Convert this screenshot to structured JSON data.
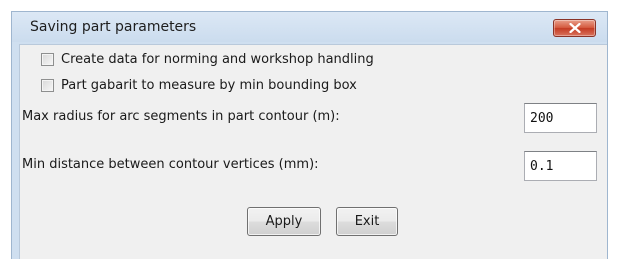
{
  "dialog": {
    "title": "Saving part parameters",
    "close_icon": "close-icon",
    "checkboxes": [
      {
        "label": "Create data for norming and workshop handling",
        "checked": false
      },
      {
        "label": "Part gabarit to measure by min bounding box",
        "checked": false
      }
    ],
    "fields": [
      {
        "label": "Max radius for arc segments in part contour (m):",
        "value": "200"
      },
      {
        "label": "Min distance between contour vertices (mm):",
        "value": "0.1"
      }
    ],
    "buttons": {
      "apply": "Apply",
      "exit": "Exit"
    },
    "colors": {
      "titlebar": "#cbdcee",
      "close_button": "#c43b23",
      "client": "#f0f0f0"
    }
  }
}
